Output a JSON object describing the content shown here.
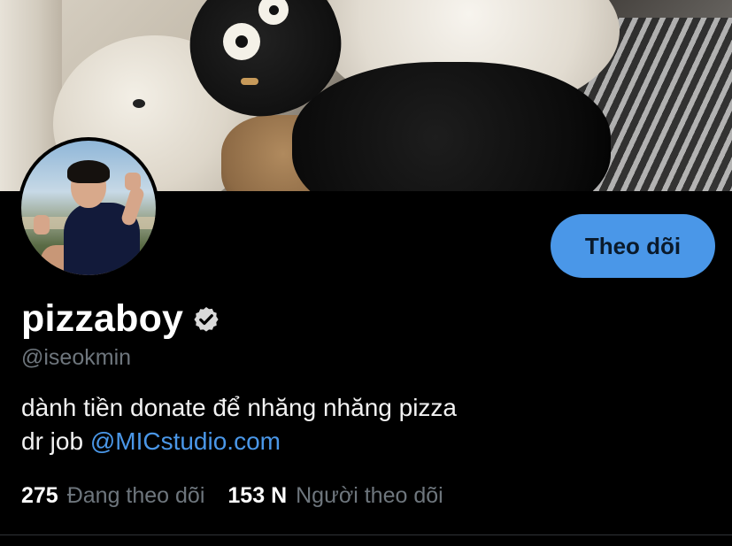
{
  "profile": {
    "display_name": "pizzaboy",
    "handle": "@iseokmin",
    "verified_icon": "verified-badge-icon",
    "follow_label": "Theo dõi",
    "bio": {
      "line1": "dành tiền donate để nhăng nhăng pizza",
      "line2_prefix": "dr job ",
      "line2_mention": "@MICstudio.com"
    },
    "stats": {
      "following_count": "275",
      "following_label": "Đang theo dõi",
      "followers_count": "153 N",
      "followers_label": "Người theo dõi"
    }
  },
  "colors": {
    "background": "#000000",
    "accent": "#4a97e8",
    "muted_text": "#6e767d"
  }
}
